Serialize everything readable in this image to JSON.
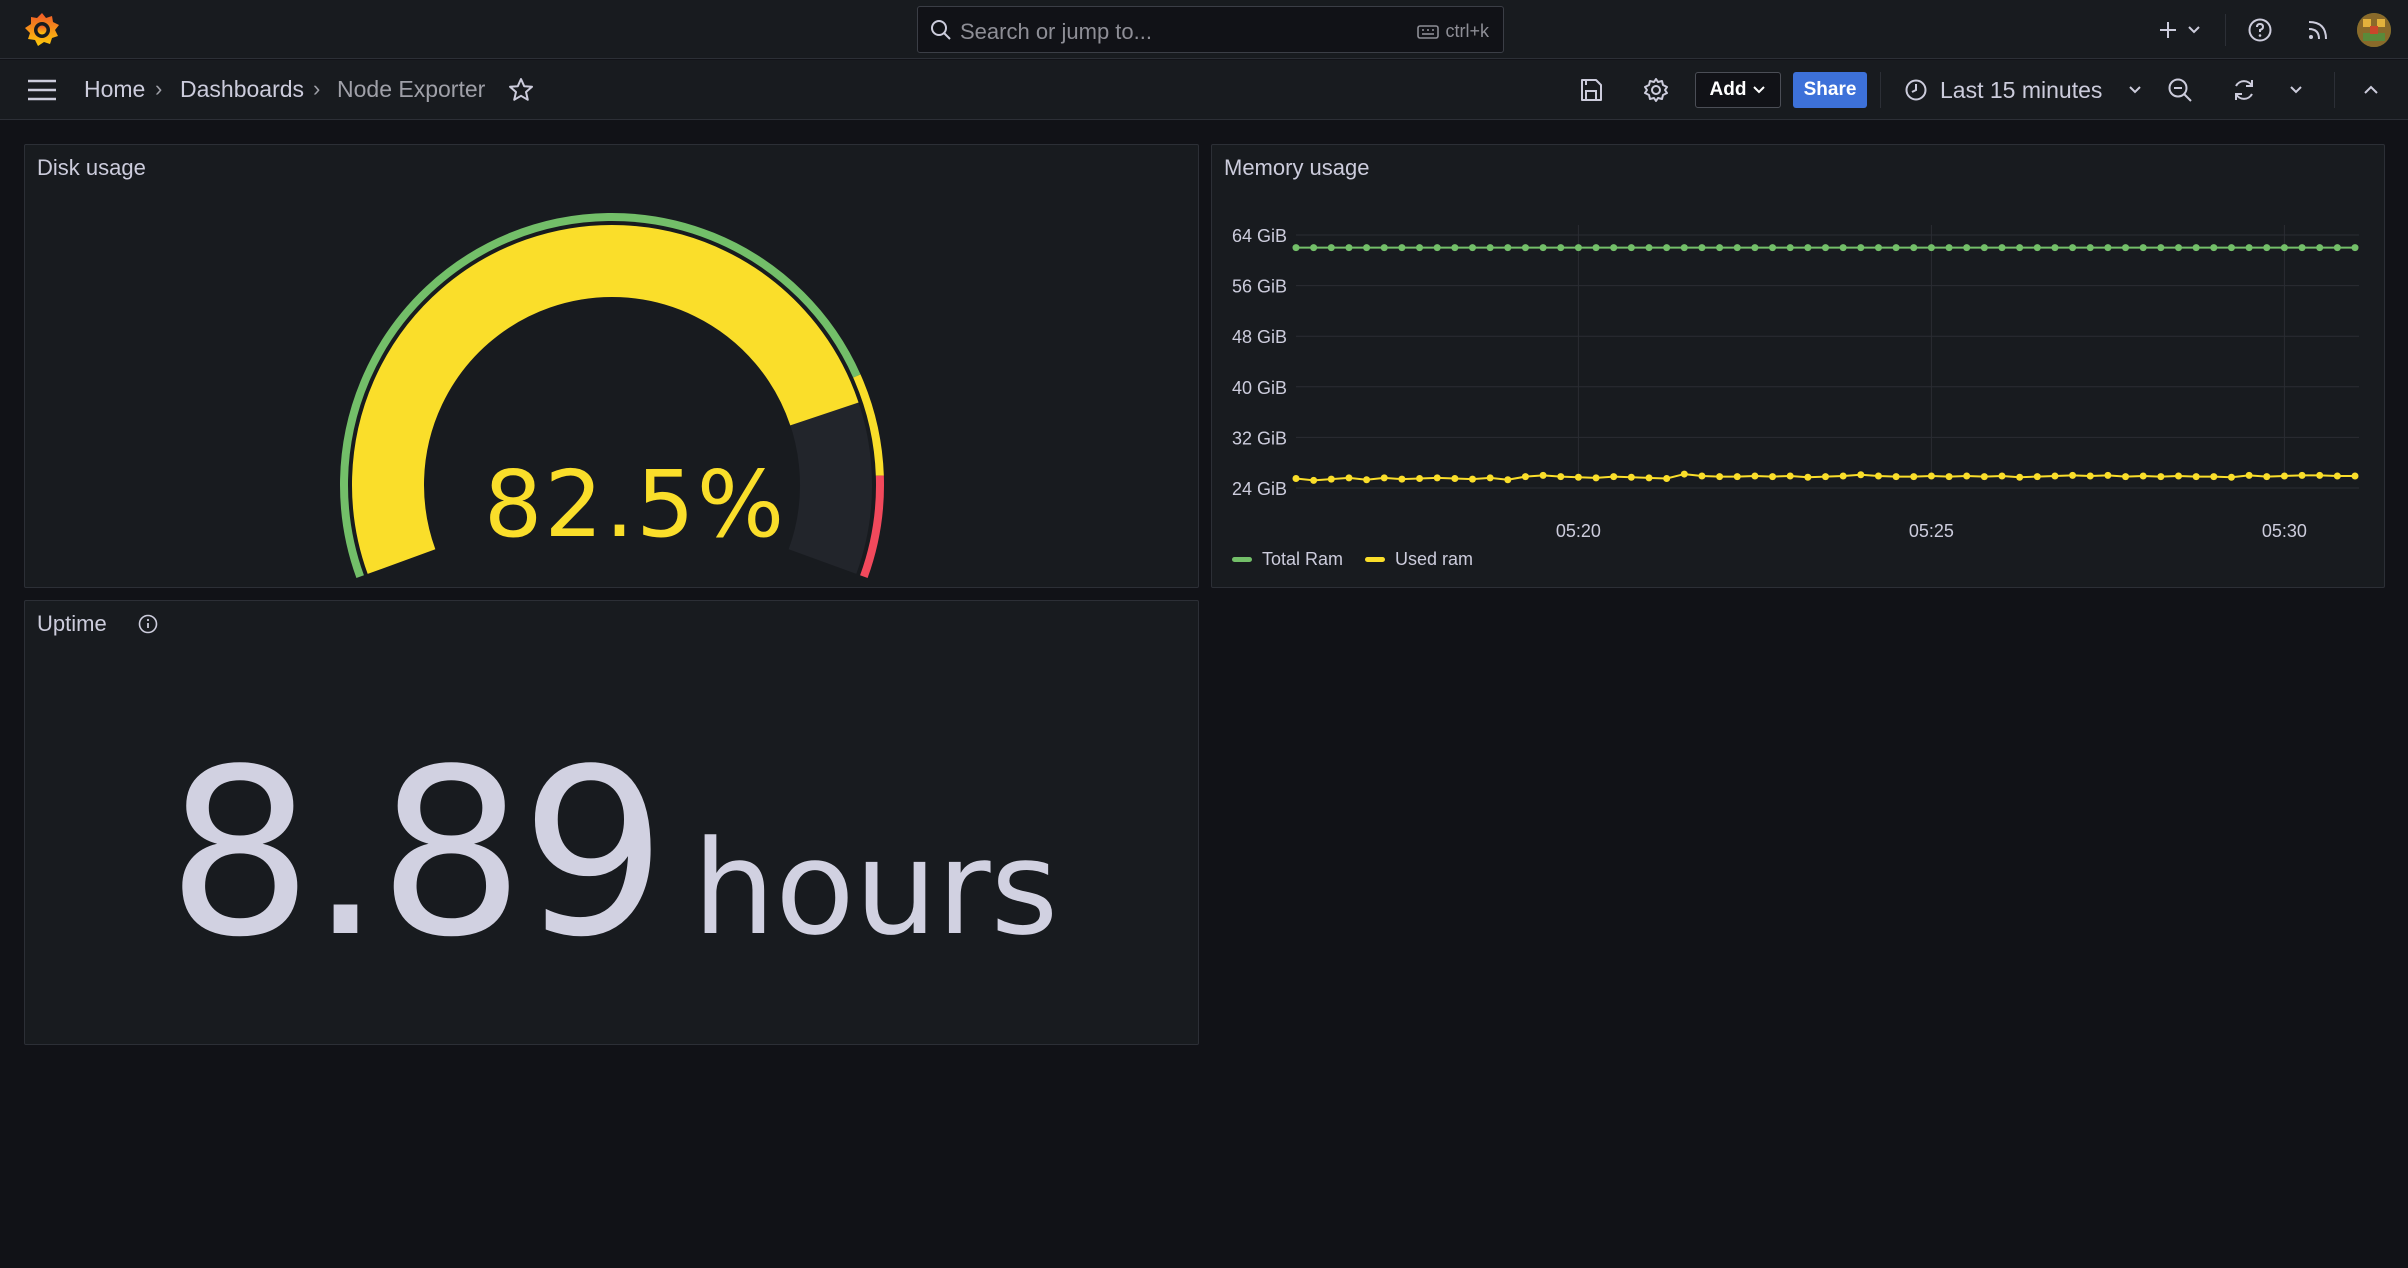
{
  "search": {
    "placeholder": "Search or jump to...",
    "shortcut": "ctrl+k"
  },
  "breadcrumb": [
    {
      "label": "Home"
    },
    {
      "label": "Dashboards"
    },
    {
      "label": "Node Exporter"
    }
  ],
  "toolbar": {
    "add_label": "Add",
    "share_label": "Share",
    "time_range": "Last 15 minutes"
  },
  "icons": [
    "grafana-logo-icon",
    "search-icon",
    "keyboard-icon",
    "plus-icon",
    "chevron-down-icon",
    "help-icon",
    "rss-icon",
    "menu-icon",
    "star-icon",
    "save-icon",
    "gear-icon",
    "clock-icon",
    "zoom-out-icon",
    "refresh-icon",
    "chevron-up-icon",
    "info-icon"
  ],
  "colors": {
    "accent_blue": "#3d71d9",
    "gauge_yellow": "#fade2a",
    "green": "#73bf69",
    "red": "#f2495c"
  },
  "panels": {
    "disk": {
      "title": "Disk usage",
      "value": "82.5%",
      "gauge_fraction": 0.825
    },
    "memory": {
      "title": "Memory usage",
      "legend": [
        {
          "name": "Total Ram",
          "color": "#73bf69"
        },
        {
          "name": "Used ram",
          "color": "#fade2a"
        }
      ]
    },
    "uptime": {
      "title": "Uptime",
      "value": "8.89",
      "unit": "hours"
    }
  },
  "chart_data": {
    "type": "line",
    "title": "Memory usage",
    "y_ticks": [
      "24 GiB",
      "32 GiB",
      "40 GiB",
      "48 GiB",
      "56 GiB",
      "64 GiB"
    ],
    "x_ticks": [
      "05:20",
      "05:25",
      "05:30"
    ],
    "ylim": [
      24,
      64
    ],
    "grid": true,
    "legend_position": "bottom-left",
    "series": [
      {
        "name": "Total Ram",
        "color": "#73bf69",
        "values": [
          62,
          62,
          62,
          62,
          62,
          62,
          62,
          62,
          62,
          62,
          62,
          62,
          62,
          62,
          62,
          62,
          62,
          62,
          62,
          62,
          62,
          62,
          62,
          62,
          62,
          62,
          62,
          62,
          62,
          62,
          62,
          62,
          62,
          62,
          62,
          62,
          62,
          62,
          62,
          62,
          62,
          62,
          62,
          62,
          62,
          62,
          62,
          62,
          62,
          62,
          62,
          62,
          62,
          62,
          62,
          62,
          62,
          62,
          62,
          62,
          62
        ]
      },
      {
        "name": "Used ram",
        "color": "#fade2a",
        "values": [
          25.5,
          25.2,
          25.4,
          25.6,
          25.3,
          25.6,
          25.4,
          25.5,
          25.6,
          25.5,
          25.4,
          25.6,
          25.3,
          25.8,
          26.0,
          25.8,
          25.7,
          25.6,
          25.8,
          25.7,
          25.6,
          25.5,
          26.2,
          25.9,
          25.8,
          25.8,
          25.9,
          25.8,
          25.9,
          25.7,
          25.8,
          25.9,
          26.1,
          25.9,
          25.8,
          25.8,
          25.9,
          25.8,
          25.9,
          25.8,
          25.9,
          25.7,
          25.8,
          25.9,
          26.0,
          25.9,
          26.0,
          25.8,
          25.9,
          25.8,
          25.9,
          25.8,
          25.8,
          25.7,
          26.0,
          25.8,
          25.9,
          26.0,
          26.0,
          25.9,
          25.9
        ]
      }
    ]
  }
}
